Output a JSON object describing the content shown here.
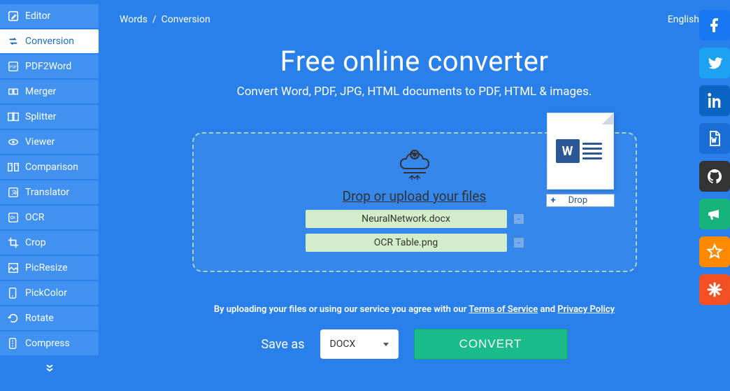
{
  "sidebar": {
    "items": [
      {
        "label": "Editor",
        "icon": "editor"
      },
      {
        "label": "Conversion",
        "icon": "conversion",
        "active": true
      },
      {
        "label": "PDF2Word",
        "icon": "pdf"
      },
      {
        "label": "Merger",
        "icon": "merger"
      },
      {
        "label": "Splitter",
        "icon": "splitter"
      },
      {
        "label": "Viewer",
        "icon": "viewer"
      },
      {
        "label": "Comparison",
        "icon": "comparison"
      },
      {
        "label": "Translator",
        "icon": "translator"
      },
      {
        "label": "OCR",
        "icon": "ocr"
      },
      {
        "label": "Crop",
        "icon": "crop"
      },
      {
        "label": "PicResize",
        "icon": "picresize"
      },
      {
        "label": "PickColor",
        "icon": "pickcolor"
      },
      {
        "label": "Rotate",
        "icon": "rotate"
      },
      {
        "label": "Compress",
        "icon": "compress"
      }
    ]
  },
  "breadcrumb": {
    "root": "Words",
    "sep": "/",
    "current": "Conversion"
  },
  "language": "English",
  "title": "Free online converter",
  "subtitle": "Convert Word, PDF, JPG, HTML documents to PDF, HTML & images.",
  "drop": {
    "prompt": "Drop or upload your files",
    "files": [
      "NeuralNetwork.docx",
      "OCR Table.png"
    ],
    "drag_hint": "Drop",
    "drag_badge": "W"
  },
  "terms": {
    "prefix": "By uploading your files or using our service you agree with our ",
    "tos": "Terms of Service",
    "mid": " and ",
    "privacy": "Privacy Policy"
  },
  "controls": {
    "save_as": "Save as",
    "format": "DOCX",
    "convert": "CONVERT"
  }
}
